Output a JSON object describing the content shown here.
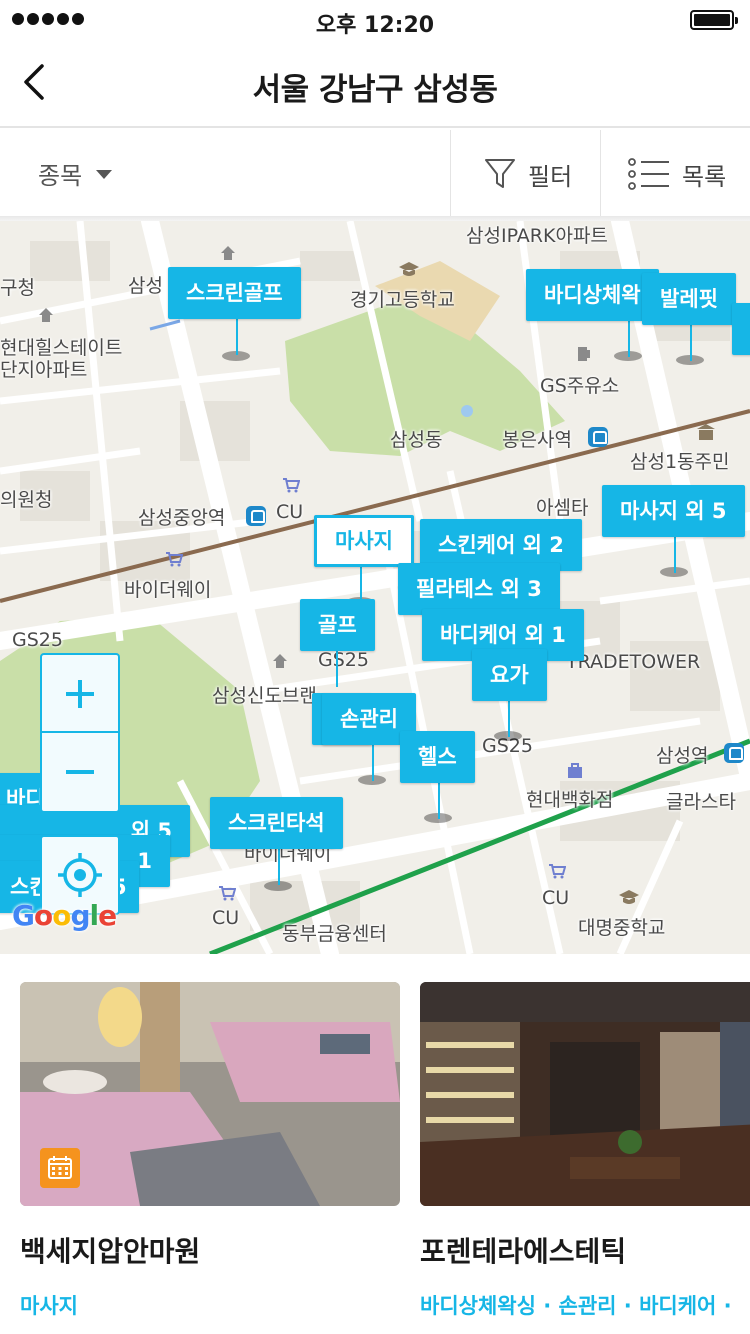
{
  "status_bar": {
    "time": "오후 12:20"
  },
  "header": {
    "title": "서울 강남구 삼성동"
  },
  "toolbar": {
    "category_label": "종목",
    "filter_label": "필터",
    "list_label": "목록"
  },
  "map": {
    "places": {
      "samsung_ipark": "삼성IPARK아파트",
      "gucheong": "구청",
      "samsung_top": "삼성",
      "gyeonggi_high": "경기고등학교",
      "hyundai_hills": "현대힐스테이트",
      "danji_apt": "단지아파트",
      "gs_station": "GS주유소",
      "samseong_dong": "삼성동",
      "bongeunsa_station": "봉은사역",
      "samsung1_center": "삼성1동주민",
      "uicheong": "의원청",
      "samsung_jungang": "삼성중앙역",
      "cu_1": "CU",
      "asem": "아셈타",
      "buy_the_way_1": "바이더웨이",
      "gs25_1": "GS25",
      "gs25_2": "GS25",
      "samsung_sindo": "삼성신도브랜",
      "trade_tower": "TRADETOWER",
      "gs25_3": "GS25",
      "samsung_station": "삼성역",
      "hyundai_dept": "현대백화점",
      "glass_tower": "글라스타",
      "buy_the_way_2": "바이더웨이",
      "cu_2": "CU",
      "cu_3": "CU",
      "dongbu": "동부금융센터",
      "daemyung": "대명중학교",
      "google": "Google"
    },
    "markers": {
      "screen_golf": "스크린골프",
      "body_waxing": "바디상체왁",
      "ballet_fit": "발레핏",
      "massage_plus5": "마사지 외 5",
      "massage": "마사지",
      "skincare_plus2": "스킨케어 외 2",
      "pilates_plus3": "필라테스 외 3",
      "golf": "골프",
      "bodycare_plus1": "바디케어 외 1",
      "yoga": "요가",
      "hand_care": "손관리",
      "health": "헬스",
      "screen_batting": "스크린타석",
      "left_1": "바디",
      "left_2": "외 5",
      "left_3": "1",
      "left_4": "스킨",
      "left_5": "5"
    }
  },
  "listings": [
    {
      "name": "백세지압안마원",
      "tags": "마사지"
    },
    {
      "name": "포렌테라에스테틱",
      "tags": "바디상체왁싱 · 손관리 · 바디케어 ·"
    }
  ],
  "colors": {
    "accent": "#16b6e6",
    "badge": "#f5931e",
    "park": "#c9dfa8",
    "subway_green": "#1fa14b",
    "subway_brown": "#8a6a4f"
  },
  "icons": [
    "back-arrow-icon",
    "chevron-down-icon",
    "filter-funnel-icon",
    "list-icon",
    "zoom-in-icon",
    "zoom-out-icon",
    "crosshair-location-icon",
    "calendar-icon",
    "home-poi-icon",
    "school-poi-icon",
    "shop-cart-icon",
    "subway-icon"
  ]
}
